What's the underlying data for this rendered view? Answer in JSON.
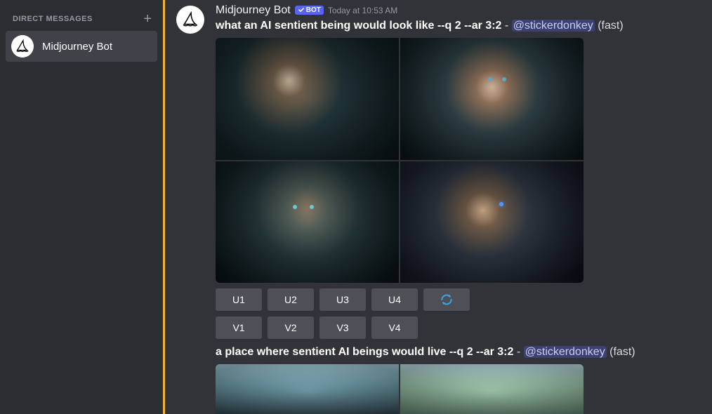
{
  "sidebar": {
    "header_label": "DIRECT MESSAGES",
    "items": [
      {
        "name": "Midjourney Bot"
      }
    ]
  },
  "message": {
    "author": "Midjourney Bot",
    "bot_tag": "BOT",
    "timestamp": "Today at 10:53 AM",
    "prompts": [
      {
        "text": "what an AI sentient being would look like --q 2 --ar 3:2",
        "mention": "@stickerdonkey",
        "mode": "(fast)"
      },
      {
        "text": "a place where sentient AI beings would live --q 2 --ar 3:2",
        "mention": "@stickerdonkey",
        "mode": "(fast)"
      }
    ],
    "buttons": {
      "u": [
        "U1",
        "U2",
        "U3",
        "U4"
      ],
      "v": [
        "V1",
        "V2",
        "V3",
        "V4"
      ]
    }
  },
  "colors": {
    "accent": "#5865f2",
    "highlight_border": "#f0b132"
  }
}
